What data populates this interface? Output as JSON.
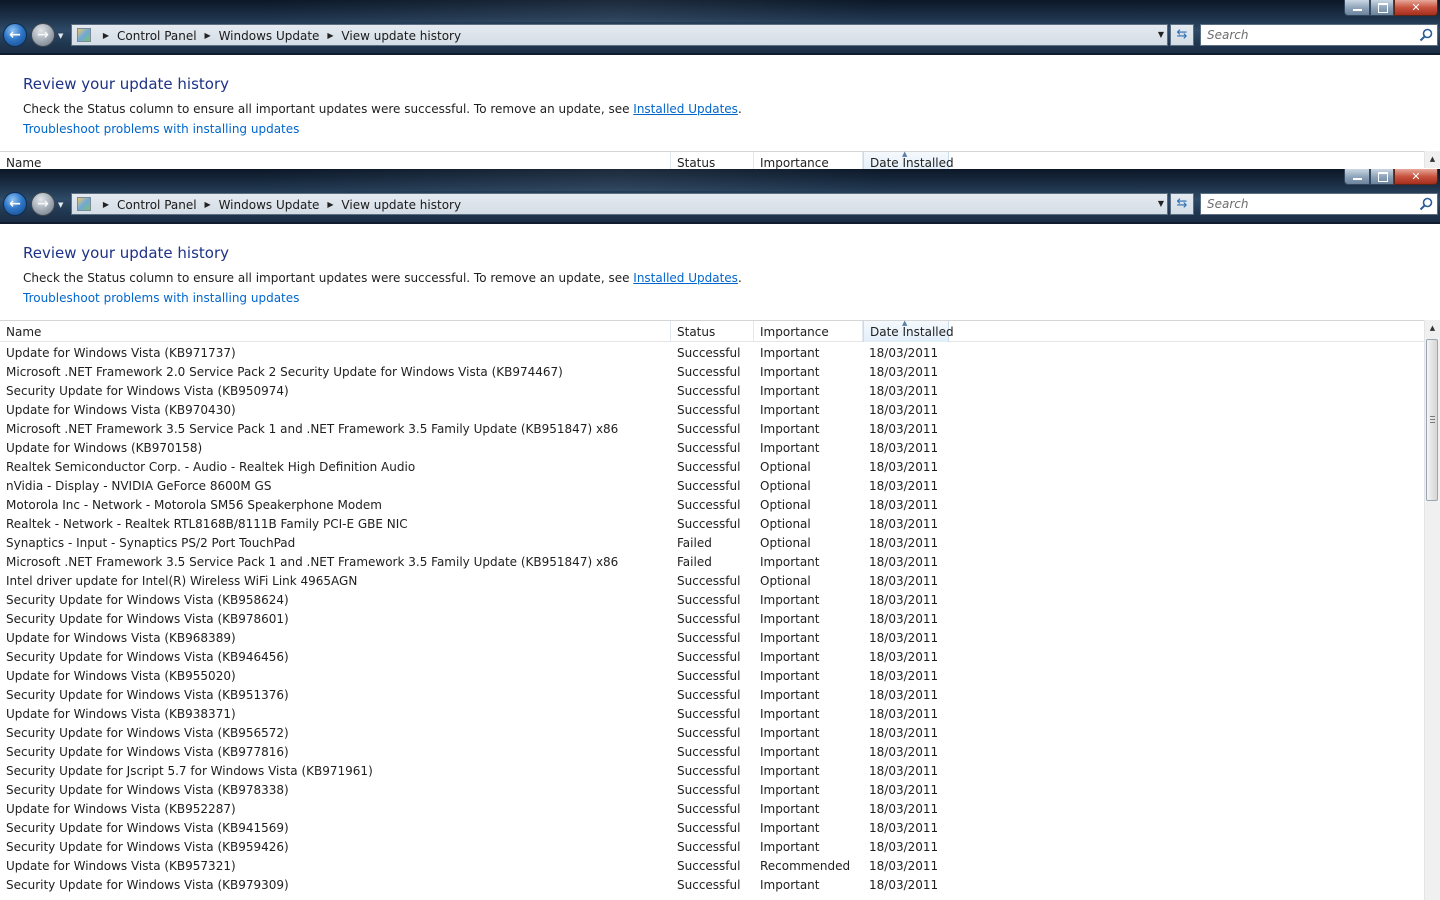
{
  "window": {
    "controls": {
      "minimize": "",
      "maximize": "",
      "close": "✕"
    }
  },
  "nav": {
    "back_glyph": "←",
    "forward_glyph": "→",
    "dropdown_glyph": "▼"
  },
  "breadcrumb": [
    "Control Panel",
    "Windows Update",
    "View update history"
  ],
  "address": {
    "separator": "▶",
    "dropdown_glyph": "▼",
    "refresh_glyph": "⇆"
  },
  "search": {
    "placeholder": "Search"
  },
  "page": {
    "title": "Review your update history",
    "description_prefix": "Check the Status column to ensure all important updates were successful. To remove an update, see ",
    "installed_updates_link": "Installed Updates",
    "description_suffix": ".",
    "troubleshoot_link": "Troubleshoot problems with installing updates"
  },
  "table": {
    "columns": {
      "name": "Name",
      "status": "Status",
      "importance": "Importance",
      "date": "Date Installed"
    },
    "sort_glyph": "▲",
    "rows": [
      {
        "name": "Update for Windows Vista (KB971737)",
        "status": "Successful",
        "importance": "Important",
        "date": "18/03/2011"
      },
      {
        "name": "Microsoft .NET Framework 2.0 Service Pack 2 Security Update for Windows Vista (KB974467)",
        "status": "Successful",
        "importance": "Important",
        "date": "18/03/2011"
      },
      {
        "name": "Security Update for Windows Vista (KB950974)",
        "status": "Successful",
        "importance": "Important",
        "date": "18/03/2011"
      },
      {
        "name": "Update for Windows Vista (KB970430)",
        "status": "Successful",
        "importance": "Important",
        "date": "18/03/2011"
      },
      {
        "name": "Microsoft .NET Framework 3.5 Service Pack 1 and .NET Framework 3.5 Family Update (KB951847) x86",
        "status": "Successful",
        "importance": "Important",
        "date": "18/03/2011"
      },
      {
        "name": "Update for Windows (KB970158)",
        "status": "Successful",
        "importance": "Important",
        "date": "18/03/2011"
      },
      {
        "name": "Realtek Semiconductor Corp. - Audio - Realtek High Definition Audio",
        "status": "Successful",
        "importance": "Optional",
        "date": "18/03/2011"
      },
      {
        "name": "nVidia - Display - NVIDIA GeForce 8600M GS",
        "status": "Successful",
        "importance": "Optional",
        "date": "18/03/2011"
      },
      {
        "name": "Motorola Inc - Network - Motorola SM56 Speakerphone Modem",
        "status": "Successful",
        "importance": "Optional",
        "date": "18/03/2011"
      },
      {
        "name": "Realtek - Network - Realtek RTL8168B/8111B Family PCI-E GBE NIC",
        "status": "Successful",
        "importance": "Optional",
        "date": "18/03/2011"
      },
      {
        "name": "Synaptics - Input - Synaptics PS/2 Port TouchPad",
        "status": "Failed",
        "importance": "Optional",
        "date": "18/03/2011"
      },
      {
        "name": "Microsoft .NET Framework 3.5 Service Pack 1 and .NET Framework 3.5 Family Update (KB951847) x86",
        "status": "Failed",
        "importance": "Important",
        "date": "18/03/2011"
      },
      {
        "name": "Intel driver update for Intel(R) Wireless WiFi Link 4965AGN",
        "status": "Successful",
        "importance": "Optional",
        "date": "18/03/2011"
      },
      {
        "name": "Security Update for Windows Vista (KB958624)",
        "status": "Successful",
        "importance": "Important",
        "date": "18/03/2011"
      },
      {
        "name": "Security Update for Windows Vista (KB978601)",
        "status": "Successful",
        "importance": "Important",
        "date": "18/03/2011"
      },
      {
        "name": "Update for Windows Vista (KB968389)",
        "status": "Successful",
        "importance": "Important",
        "date": "18/03/2011"
      },
      {
        "name": "Security Update for Windows Vista (KB946456)",
        "status": "Successful",
        "importance": "Important",
        "date": "18/03/2011"
      },
      {
        "name": "Update for Windows Vista (KB955020)",
        "status": "Successful",
        "importance": "Important",
        "date": "18/03/2011"
      },
      {
        "name": "Security Update for Windows Vista (KB951376)",
        "status": "Successful",
        "importance": "Important",
        "date": "18/03/2011"
      },
      {
        "name": "Update for Windows Vista (KB938371)",
        "status": "Successful",
        "importance": "Important",
        "date": "18/03/2011"
      },
      {
        "name": "Security Update for Windows Vista (KB956572)",
        "status": "Successful",
        "importance": "Important",
        "date": "18/03/2011"
      },
      {
        "name": "Security Update for Windows Vista (KB977816)",
        "status": "Successful",
        "importance": "Important",
        "date": "18/03/2011"
      },
      {
        "name": "Security Update for Jscript 5.7 for Windows Vista (KB971961)",
        "status": "Successful",
        "importance": "Important",
        "date": "18/03/2011"
      },
      {
        "name": "Security Update for Windows Vista (KB978338)",
        "status": "Successful",
        "importance": "Important",
        "date": "18/03/2011"
      },
      {
        "name": "Update for Windows Vista (KB952287)",
        "status": "Successful",
        "importance": "Important",
        "date": "18/03/2011"
      },
      {
        "name": "Security Update for Windows Vista (KB941569)",
        "status": "Successful",
        "importance": "Important",
        "date": "18/03/2011"
      },
      {
        "name": "Security Update for Windows Vista (KB959426)",
        "status": "Successful",
        "importance": "Important",
        "date": "18/03/2011"
      },
      {
        "name": "Update for Windows Vista (KB957321)",
        "status": "Successful",
        "importance": "Recommended",
        "date": "18/03/2011"
      },
      {
        "name": "Security Update for Windows Vista (KB979309)",
        "status": "Successful",
        "importance": "Important",
        "date": "18/03/2011"
      }
    ]
  },
  "scrollbar": {
    "up_glyph": "▲"
  },
  "colors": {
    "title_blue": "#1e3287",
    "link_blue": "#0066cc",
    "titlebar_dark": "#1c3047"
  }
}
